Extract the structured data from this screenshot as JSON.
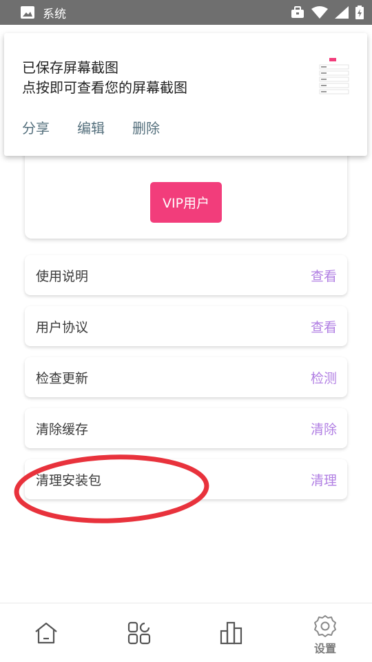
{
  "status_bar": {
    "app_label": "系统",
    "icons": [
      "image-icon",
      "briefcase-icon",
      "wifi-icon",
      "signal-icon",
      "battery-icon"
    ]
  },
  "notification": {
    "title": "已保存屏幕截图",
    "text": "点按即可查看您的屏幕截图",
    "actions": [
      "分享",
      "编辑",
      "删除"
    ]
  },
  "vip": {
    "button_label": "VIP用户"
  },
  "settings": [
    {
      "label": "使用说明",
      "action": "查看"
    },
    {
      "label": "用户协议",
      "action": "查看"
    },
    {
      "label": "检查更新",
      "action": "检测"
    },
    {
      "label": "清除缓存",
      "action": "清除"
    },
    {
      "label": "清理安装包",
      "action": "清理"
    }
  ],
  "bottom_nav": {
    "items": [
      {
        "icon": "home-icon"
      },
      {
        "icon": "apps-icon"
      },
      {
        "icon": "chart-icon"
      },
      {
        "icon": "gear-icon",
        "label": "设置"
      }
    ]
  },
  "colors": {
    "accent_pink": "#f23d7b",
    "action_purple": "#b17fe3",
    "status_bar": "#6f6f6f",
    "annotation_red": "#e8323c"
  }
}
